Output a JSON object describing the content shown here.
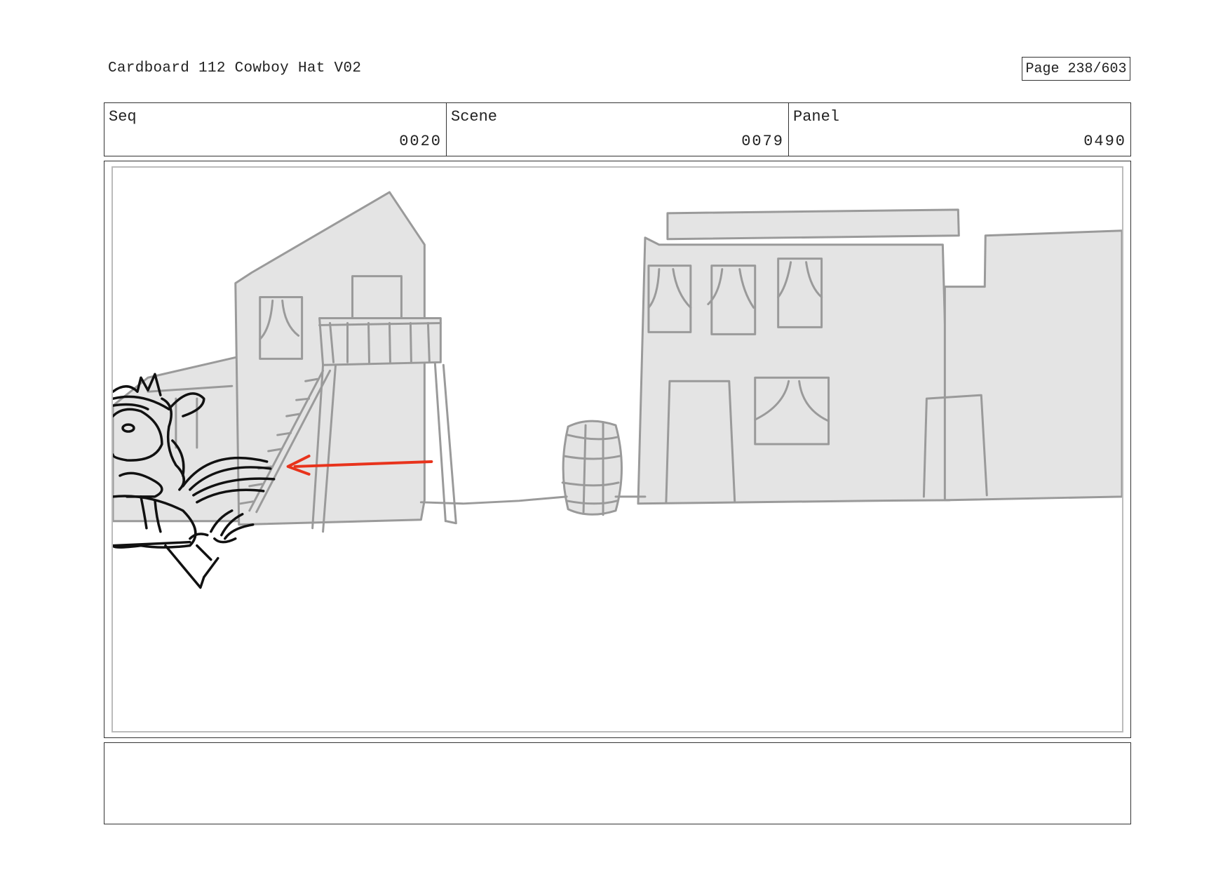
{
  "header": {
    "title": "Cardboard 112 Cowboy Hat V02",
    "page_label": "Page 238/603"
  },
  "info": {
    "seq": {
      "label": "Seq",
      "value": "0020"
    },
    "scene": {
      "label": "Scene",
      "value": "0079"
    },
    "panel": {
      "label": "Panel",
      "value": "0490"
    }
  },
  "colors": {
    "sketch_fill": "#e4e4e4",
    "sketch_line": "#9a9a9a",
    "character_line": "#111111",
    "arrow": "#e8331c"
  },
  "notes": {
    "text": ""
  }
}
